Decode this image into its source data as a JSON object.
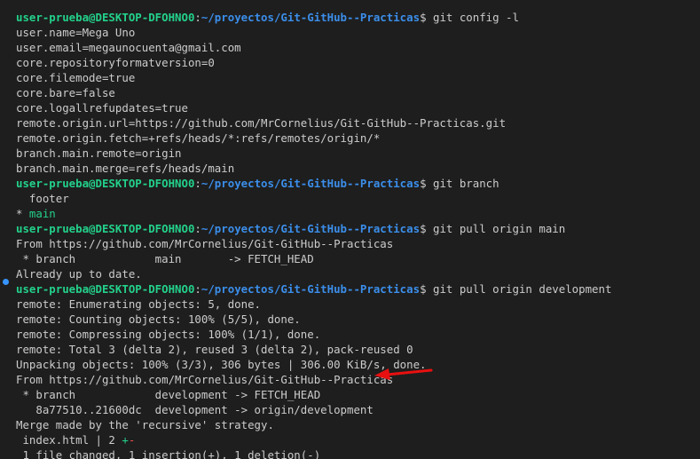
{
  "terminal": {
    "colors": {
      "background": "#1e1e1e",
      "text": "#cccccc",
      "prompt_user": "#23d18b",
      "prompt_path": "#3b8eea",
      "annotation_arrow": "#e81010"
    },
    "lines": [
      {
        "kind": "text",
        "segments": [
          {
            "text": "",
            "cls": ""
          }
        ]
      },
      {
        "kind": "prompt",
        "user": "user-prueba@DESKTOP-DFOHNO0",
        "sep": ":",
        "path": "~/proyectos/Git-GitHub--Practicas",
        "symbol": "$ ",
        "command": "git config -l"
      },
      {
        "kind": "text",
        "segments": [
          {
            "text": "user.name=Mega Uno",
            "cls": ""
          }
        ]
      },
      {
        "kind": "text",
        "segments": [
          {
            "text": "user.email=megaunocuenta@gmail.com",
            "cls": ""
          }
        ]
      },
      {
        "kind": "text",
        "segments": [
          {
            "text": "core.repositoryformatversion=0",
            "cls": ""
          }
        ]
      },
      {
        "kind": "text",
        "segments": [
          {
            "text": "core.filemode=true",
            "cls": ""
          }
        ]
      },
      {
        "kind": "text",
        "segments": [
          {
            "text": "core.bare=false",
            "cls": ""
          }
        ]
      },
      {
        "kind": "text",
        "segments": [
          {
            "text": "core.logallrefupdates=true",
            "cls": ""
          }
        ]
      },
      {
        "kind": "text",
        "segments": [
          {
            "text": "remote.origin.url=https://github.com/MrCornelius/Git-GitHub--Practicas.git",
            "cls": ""
          }
        ]
      },
      {
        "kind": "text",
        "segments": [
          {
            "text": "remote.origin.fetch=+refs/heads/*:refs/remotes/origin/*",
            "cls": ""
          }
        ]
      },
      {
        "kind": "text",
        "segments": [
          {
            "text": "branch.main.remote=origin",
            "cls": ""
          }
        ]
      },
      {
        "kind": "text",
        "segments": [
          {
            "text": "branch.main.merge=refs/heads/main",
            "cls": ""
          }
        ]
      },
      {
        "kind": "prompt",
        "user": "user-prueba@DESKTOP-DFOHNO0",
        "sep": ":",
        "path": "~/proyectos/Git-GitHub--Practicas",
        "symbol": "$ ",
        "command": "git branch"
      },
      {
        "kind": "text",
        "segments": [
          {
            "text": "  footer",
            "cls": ""
          }
        ]
      },
      {
        "kind": "text",
        "segments": [
          {
            "text": "* ",
            "cls": ""
          },
          {
            "text": "main",
            "cls": "git-branch"
          }
        ]
      },
      {
        "kind": "prompt",
        "user": "user-prueba@DESKTOP-DFOHNO0",
        "sep": ":",
        "path": "~/proyectos/Git-GitHub--Practicas",
        "symbol": "$ ",
        "command": "git pull origin main"
      },
      {
        "kind": "text",
        "segments": [
          {
            "text": "From https://github.com/MrCornelius/Git-GitHub--Practicas",
            "cls": ""
          }
        ]
      },
      {
        "kind": "text",
        "segments": [
          {
            "text": " * branch            main       -> FETCH_HEAD",
            "cls": ""
          }
        ]
      },
      {
        "kind": "text",
        "segments": [
          {
            "text": "Already up to date.",
            "cls": ""
          }
        ]
      },
      {
        "kind": "prompt",
        "user": "user-prueba@DESKTOP-DFOHNO0",
        "sep": ":",
        "path": "~/proyectos/Git-GitHub--Practicas",
        "symbol": "$ ",
        "command": "git pull origin development"
      },
      {
        "kind": "text",
        "segments": [
          {
            "text": "remote: Enumerating objects: 5, done.",
            "cls": ""
          }
        ]
      },
      {
        "kind": "text",
        "segments": [
          {
            "text": "remote: Counting objects: 100% (5/5), done.",
            "cls": ""
          }
        ]
      },
      {
        "kind": "text",
        "segments": [
          {
            "text": "remote: Compressing objects: 100% (1/1), done.",
            "cls": ""
          }
        ]
      },
      {
        "kind": "text",
        "segments": [
          {
            "text": "remote: Total 3 (delta 2), reused 3 (delta 2), pack-reused 0",
            "cls": ""
          }
        ]
      },
      {
        "kind": "text",
        "segments": [
          {
            "text": "Unpacking objects: 100% (3/3), 306 bytes | 306.00 KiB/s, done.",
            "cls": ""
          }
        ]
      },
      {
        "kind": "text",
        "segments": [
          {
            "text": "From https://github.com/MrCornelius/Git-GitHub--Practicas",
            "cls": ""
          }
        ]
      },
      {
        "kind": "text",
        "segments": [
          {
            "text": " * branch            development -> FETCH_HEAD",
            "cls": ""
          }
        ]
      },
      {
        "kind": "text",
        "segments": [
          {
            "text": "   8a77510..21600dc  development -> origin/development",
            "cls": ""
          }
        ]
      },
      {
        "kind": "text",
        "segments": [
          {
            "text": "Merge made by the 'recursive' strategy.",
            "cls": ""
          }
        ]
      },
      {
        "kind": "text",
        "segments": [
          {
            "text": " index.html | 2 ",
            "cls": ""
          },
          {
            "text": "+",
            "cls": "git-branch"
          },
          {
            "text": "-",
            "cls": "git-del"
          }
        ]
      },
      {
        "kind": "text",
        "segments": [
          {
            "text": " 1 file changed, 1 insertion(+), 1 deletion(-)",
            "cls": ""
          }
        ]
      }
    ]
  }
}
